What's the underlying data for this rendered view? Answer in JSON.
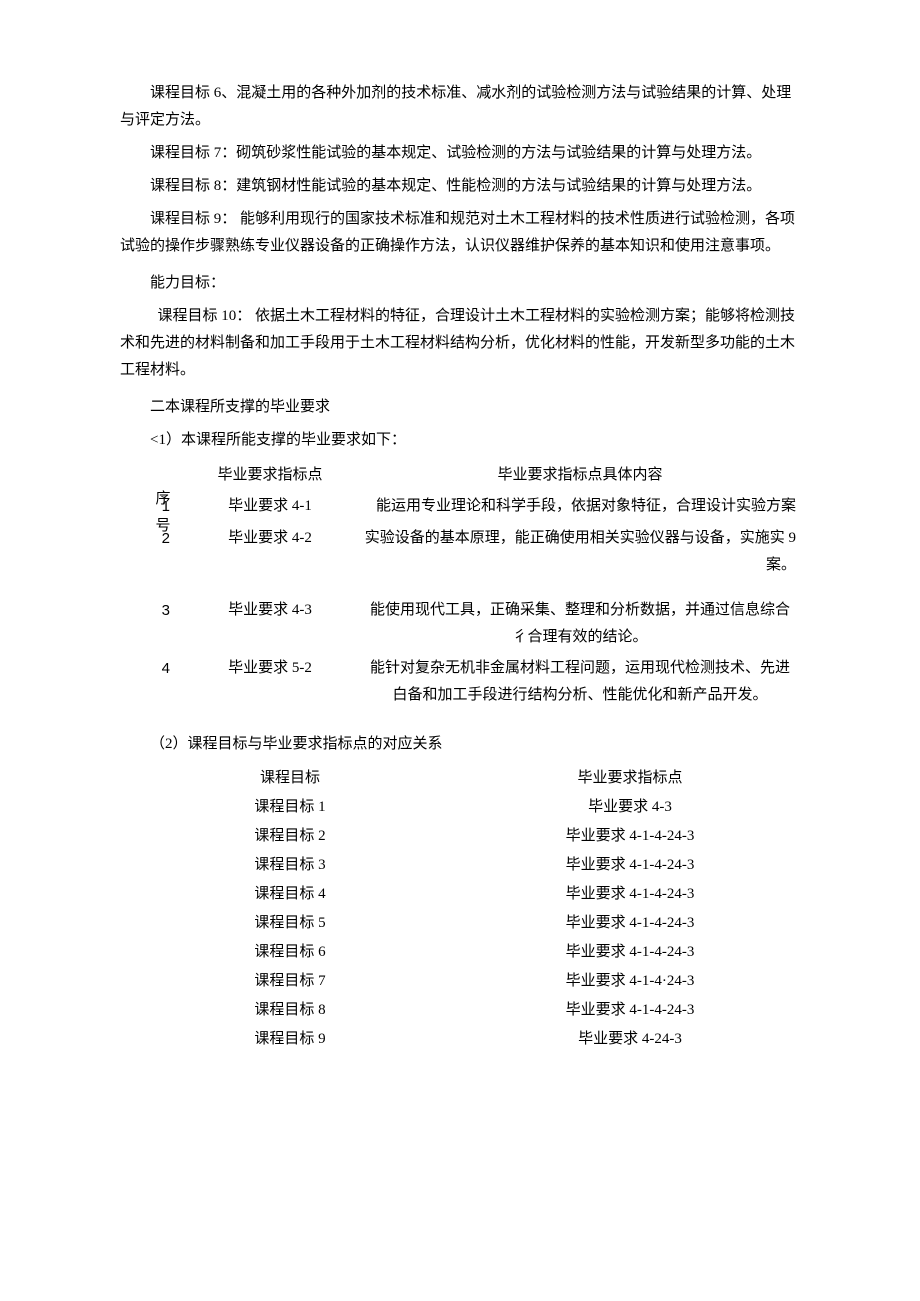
{
  "paragraphs": {
    "p1": "课程目标 6、混凝土用的各种外加剂的技术标准、减水剂的试验检测方法与试验结果的计算、处理与评定方法。",
    "p2": "课程目标 7：砌筑砂浆性能试验的基本规定、试验检测的方法与试验结果的计算与处理方法。",
    "p3": "课程目标 8：建筑钢材性能试验的基本规定、性能检测的方法与试验结果的计算与处理方法。",
    "p4": "课程目标 9： 能够利用现行的国家技术标准和规范对土木工程材料的技术性质进行试验检测，各项试验的操作步骤熟练专业仪器设备的正确操作方法，认识仪器维护保养的基本知识和使用注意事项。",
    "p5": "能力目标：",
    "p6": "课程目标 10： 依据土木工程材料的特征，合理设计土木工程材料的实验检测方案；能够将检测技术和先进的材料制备和加工手段用于土木工程材料结构分析，优化材料的性能，开发新型多功能的土木工程材料。",
    "h1": "二本课程所支撑的毕业要求",
    "sub1": "<1）本课程所能支撑的毕业要求如下：",
    "sub2": "（2）课程目标与毕业要求指标点的对应关系"
  },
  "table1": {
    "header_seq": "序号",
    "header_ind": "毕业要求指标点",
    "header_content": "毕业要求指标点具体内容",
    "rows": [
      {
        "seq": "1",
        "ind": "毕业要求 4-1",
        "content": "能运用专业理论和科学手段，依据对象特征，合理设计实验方案"
      },
      {
        "seq": "2",
        "ind": "毕业要求 4-2",
        "content": "实验设备的基本原理，能正确使用相关实验仪器与设备，实施实 9 案。"
      },
      {
        "seq": "3",
        "ind": "毕业要求 4-3",
        "content": "能使用现代工具，正确采集、整理和分析数据，并通过信息综合彳合理有效的结论。"
      },
      {
        "seq": "4",
        "ind": "毕业要求 5-2",
        "content": "能针对复杂无机非金属材料工程问题，运用现代检测技术、先进白备和加工手段进行结构分析、性能优化和新产品开发。"
      }
    ]
  },
  "table2": {
    "header_obj": "课程目标",
    "header_req": "毕业要求指标点",
    "rows": [
      {
        "obj": "课程目标 1",
        "req": "毕业要求 4-3"
      },
      {
        "obj": "课程目标 2",
        "req": "毕业要求 4-1-4-24-3"
      },
      {
        "obj": "课程目标 3",
        "req": "毕业要求 4-1-4-24-3"
      },
      {
        "obj": "课程目标 4",
        "req": "毕业要求 4-1-4-24-3"
      },
      {
        "obj": "课程目标 5",
        "req": "毕业要求 4-1-4-24-3"
      },
      {
        "obj": "课程目标 6",
        "req": "毕业要求 4-1-4-24-3"
      },
      {
        "obj": "课程目标 7",
        "req": "毕业要求 4-1-4·24-3"
      },
      {
        "obj": "课程目标 8",
        "req": "毕业要求 4-1-4-24-3"
      },
      {
        "obj": "课程目标 9",
        "req": "毕业要求 4-24-3"
      }
    ]
  }
}
